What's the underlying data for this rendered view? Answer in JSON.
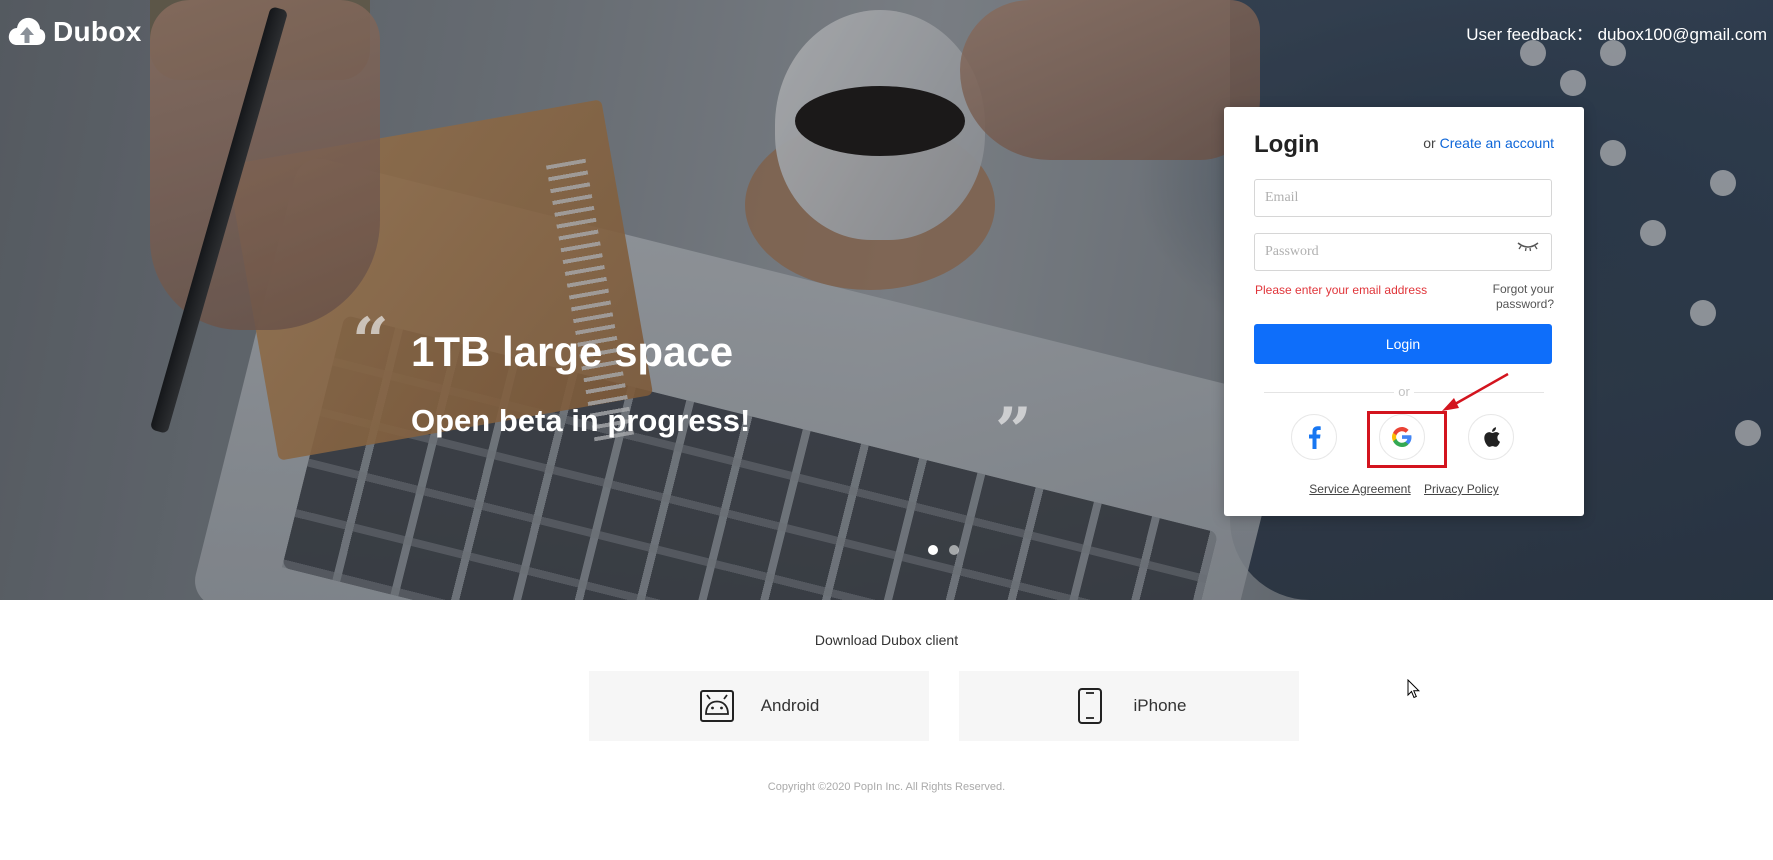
{
  "brand": {
    "name": "Dubox"
  },
  "header": {
    "feedback": "User feedback： dubox100@gmail.com"
  },
  "hero": {
    "title": "1TB large space",
    "subtitle": "Open beta in progress!",
    "quote_open": "“",
    "quote_close": "”",
    "carousel": {
      "count": 2,
      "active": 1
    }
  },
  "login": {
    "title": "Login",
    "create_prefix": "or",
    "create_link": "Create an account",
    "email_placeholder": "Email",
    "password_placeholder": "Password",
    "error": "Please enter your email address",
    "forgot": "Forgot your password?",
    "button": "Login",
    "or": "or",
    "social": [
      "facebook-icon",
      "google-icon",
      "apple-icon"
    ],
    "highlighted_social": "google-icon",
    "service_agreement": "Service Agreement",
    "privacy_policy": "Privacy Policy"
  },
  "download": {
    "title": "Download Dubox client",
    "android": "Android",
    "iphone": "iPhone"
  },
  "footer": {
    "copyright": "Copyright ©2020 PopIn Inc. All Rights Reserved."
  },
  "colors": {
    "primary": "#0e6efa",
    "link": "#0e66d8",
    "error": "#e0353a",
    "annotation": "#d3141e"
  }
}
